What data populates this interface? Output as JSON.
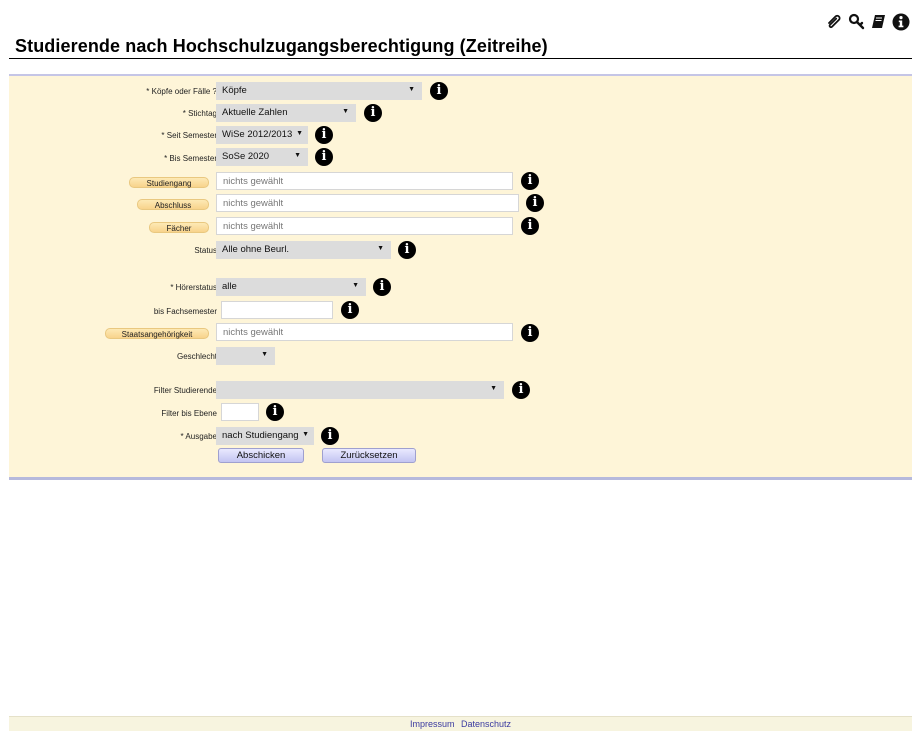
{
  "header": {
    "title": "Studierende nach Hochschulzugangsberechtigung (Zeitreihe)",
    "toolbar_icons": [
      "paperclip-icon",
      "search-icon",
      "book-icon",
      "info-icon"
    ]
  },
  "form": {
    "koepfe_label": "* Köpfe oder Fälle ?",
    "koepfe_value": "Köpfe",
    "stichtag_label": "* Stichtag",
    "stichtag_value": "Aktuelle Zahlen",
    "seit_label": "* Seit Semester",
    "seit_value": "WiSe 2012/2013",
    "bis_label": "* Bis Semester",
    "bis_value": "SoSe 2020",
    "studiengang_label": "Studiengang",
    "studiengang_value": "nichts gewählt",
    "abschluss_label": "Abschluss",
    "abschluss_value": "nichts gewählt",
    "faecher_label": "Fächer",
    "faecher_value": "nichts gewählt",
    "status_label": "Status",
    "status_value": "Alle ohne Beurl.",
    "hoererstatus_label": "* Hörerstatus",
    "hoererstatus_value": "alle",
    "bisfs_label": "bis Fachsemester",
    "bisfs_value": "",
    "staat_label": "Staatsangehörigkeit",
    "staat_value": "nichts gewählt",
    "geschlecht_label": "Geschlecht",
    "geschlecht_value": "",
    "filter_label": "Filter Studierende",
    "filter_value": "",
    "ebene_label": "Filter bis Ebene",
    "ebene_value": "",
    "ausgabe_label": "* Ausgabe",
    "ausgabe_value": "nach Studiengang",
    "submit_label": "Abschicken",
    "reset_label": "Zurücksetzen",
    "info_glyph": "i",
    "arrow_glyph": "▼"
  },
  "footer": {
    "impressum": "Impressum",
    "datenschutz": "Datenschutz"
  }
}
